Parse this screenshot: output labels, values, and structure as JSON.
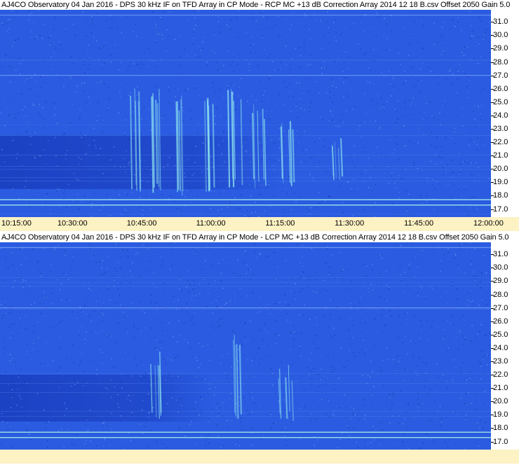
{
  "colors": {
    "background_blue": "#2a5be0",
    "band_dark_blue": "#1a3fc0",
    "burst_cyan": "#8fe6f0",
    "axis_strip": "#fdf2c4"
  },
  "chart_data": [
    {
      "type": "heatmap",
      "title": "AJ4CO Observatory 04 Jan 2016 - DPS 30 kHz IF on TFD Array in CP Mode - RCP  MC +13 dB  Correction Array 2014 12 18 B.csv  Offset 2050  Gain 5.0",
      "xlabel": "",
      "ylabel": "",
      "x_ticks": [
        "10:15:00",
        "10:30:00",
        "10:45:00",
        "11:00:00",
        "11:15:00",
        "11:30:00",
        "11:45:00",
        "12:00:00"
      ],
      "y_ticks": [
        "31.0",
        "30.0",
        "29.0",
        "28.0",
        "27.0",
        "26.0",
        "25.0",
        "24.0",
        "23.0",
        "22.0",
        "21.0",
        "20.0",
        "19.0",
        "18.0",
        "17.0"
      ],
      "ylim": [
        16.4,
        31.9
      ],
      "polarization": "RCP",
      "horizontal_lines_MHz": [
        31.5,
        27.0,
        17.7,
        17.3
      ],
      "bursts": [
        {
          "t": "10:44:00",
          "f_low": 18.0,
          "f_high": 26.5
        },
        {
          "t": "10:48:00",
          "f_low": 18.2,
          "f_high": 26.0
        },
        {
          "t": "10:54:00",
          "f_low": 18.0,
          "f_high": 25.5
        },
        {
          "t": "11:00:00",
          "f_low": 18.2,
          "f_high": 26.0
        },
        {
          "t": "11:05:00",
          "f_low": 18.5,
          "f_high": 26.5
        },
        {
          "t": "11:10:00",
          "f_low": 18.5,
          "f_high": 25.0
        },
        {
          "t": "11:16:00",
          "f_low": 18.5,
          "f_high": 24.0
        },
        {
          "t": "11:27:00",
          "f_low": 19.0,
          "f_high": 23.0
        }
      ],
      "dark_band_MHz": [
        18.5,
        22.5
      ],
      "dark_band_time": [
        "10:15:00",
        "11:15:00"
      ]
    },
    {
      "type": "heatmap",
      "title": "AJ4CO Observatory 04 Jan 2016 - DPS 30 kHz IF on TFD Array in CP Mode - LCP  MC +13 dB  Correction Array 2014 12 18 B.csv  Offset 2050  Gain 5.0",
      "xlabel": "",
      "ylabel": "",
      "x_ticks": [],
      "y_ticks": [
        "31.0",
        "30.0",
        "29.0",
        "28.0",
        "27.0",
        "26.0",
        "25.0",
        "24.0",
        "23.0",
        "22.0",
        "21.0",
        "20.0",
        "19.0",
        "18.0",
        "17.0"
      ],
      "ylim": [
        16.4,
        31.9
      ],
      "polarization": "LCP",
      "horizontal_lines_MHz": [
        31.5,
        27.0,
        17.7,
        17.3
      ],
      "bursts": [
        {
          "t": "10:48:00",
          "f_low": 18.5,
          "f_high": 24.0
        },
        {
          "t": "11:05:00",
          "f_low": 18.5,
          "f_high": 25.0
        },
        {
          "t": "11:16:00",
          "f_low": 18.5,
          "f_high": 23.0
        }
      ],
      "dark_band_MHz": [
        18.5,
        22.0
      ],
      "dark_band_time": [
        "10:15:00",
        "11:00:00"
      ]
    }
  ]
}
